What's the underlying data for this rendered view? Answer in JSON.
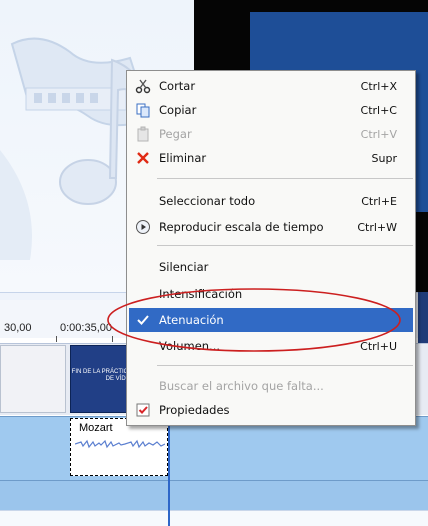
{
  "timeline": {
    "ticks": [
      "30,00",
      "0:00:35,00"
    ],
    "video_clip_text": "FIN DE LA PRÁCTICA DE EDICIÓN DE VÍDEO",
    "audio_clip_name": "Mozart"
  },
  "context_menu": {
    "items": [
      {
        "label": "Cortar",
        "shortcut": "Ctrl+X",
        "icon": "scissors-icon",
        "disabled": false
      },
      {
        "label": "Copiar",
        "shortcut": "Ctrl+C",
        "icon": "copy-icon",
        "disabled": false
      },
      {
        "label": "Pegar",
        "shortcut": "Ctrl+V",
        "icon": "paste-icon",
        "disabled": true
      },
      {
        "label": "Eliminar",
        "shortcut": "Supr",
        "icon": "delete-x-icon",
        "disabled": false
      },
      {
        "label": "Seleccionar todo",
        "shortcut": "Ctrl+E",
        "icon": "",
        "disabled": false
      },
      {
        "label": "Reproducir escala de tiempo",
        "shortcut": "Ctrl+W",
        "icon": "play-circle-icon",
        "disabled": false
      },
      {
        "label": "Silenciar",
        "shortcut": "",
        "icon": "",
        "disabled": false
      },
      {
        "label": "Intensificación",
        "shortcut": "",
        "icon": "",
        "disabled": false
      },
      {
        "label": "Atenuación",
        "shortcut": "",
        "icon": "checkmark-icon",
        "disabled": false,
        "highlighted": true,
        "checked": true
      },
      {
        "label": "Volumen...",
        "shortcut": "Ctrl+U",
        "icon": "",
        "disabled": false
      },
      {
        "label": "Buscar el archivo que falta...",
        "shortcut": "",
        "icon": "",
        "disabled": true
      },
      {
        "label": "Propiedades",
        "shortcut": "",
        "icon": "properties-icon",
        "disabled": false
      }
    ]
  },
  "colors": {
    "highlight": "#316ac5",
    "annotation_oval": "#cc1f1f",
    "audio_track": "#9fc9ef",
    "video_clip": "#213f86"
  }
}
